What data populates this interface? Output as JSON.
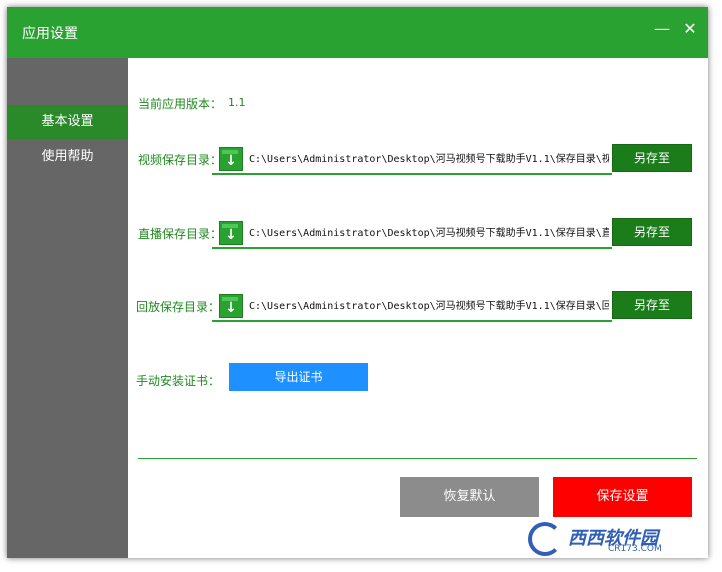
{
  "window": {
    "title": "应用设置",
    "minimize": "—",
    "close": "✕"
  },
  "sidebar": {
    "items": [
      {
        "label": "基本设置",
        "active": true
      },
      {
        "label": "使用帮助",
        "active": false
      }
    ]
  },
  "settings": {
    "version_label": "当前应用版本：",
    "version_value": "1.1",
    "video_dir_label": "视频保存目录：",
    "video_dir_value": "C:\\Users\\Administrator\\Desktop\\河马视频号下载助手V1.1\\保存目录\\视频",
    "live_dir_label": "直播保存目录：",
    "live_dir_value": "C:\\Users\\Administrator\\Desktop\\河马视频号下载助手V1.1\\保存目录\\直播",
    "replay_dir_label": "回放保存目录：",
    "replay_dir_value": "C:\\Users\\Administrator\\Desktop\\河马视频号下载助手V1.1\\保存目录\\回放",
    "save_as_label": "另存至",
    "cert_label": "手动安装证书：",
    "export_cert_label": "导出证书"
  },
  "footer": {
    "reset_label": "恢复默认",
    "save_label": "保存设置"
  },
  "watermark": {
    "text": "西西软件园",
    "sub": "CR173.COM"
  },
  "colors": {
    "title_bar": "#2aa232",
    "sidebar": "#666666",
    "accent": "#1a7d1a",
    "danger": "#ff0000",
    "info": "#1e90ff"
  }
}
